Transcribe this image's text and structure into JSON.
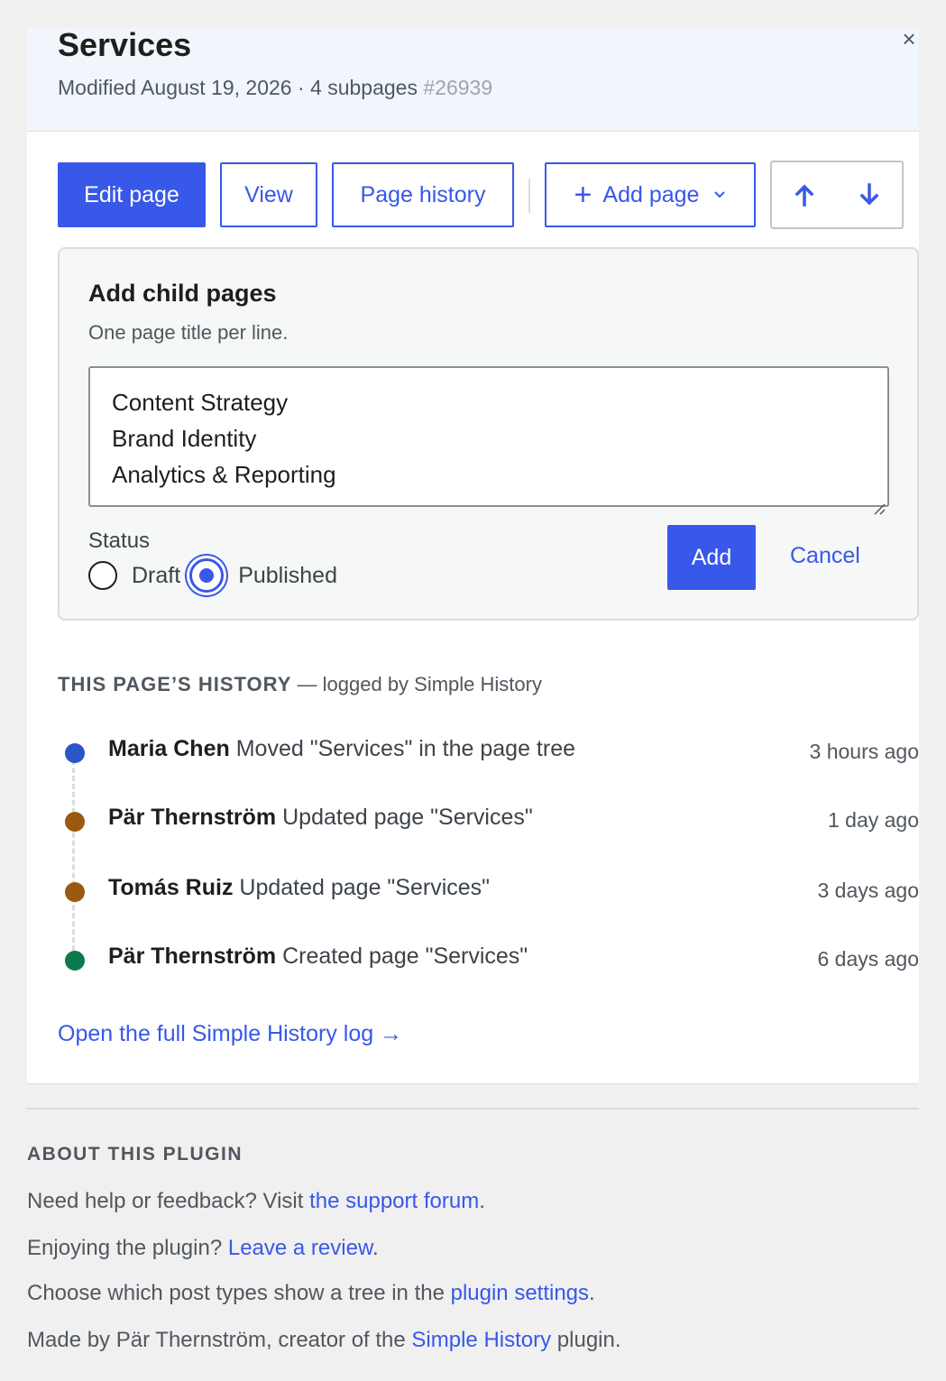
{
  "header": {
    "title": "Services",
    "modified": "Modified August 19, 2026",
    "separator": "·",
    "subpages": "4 subpages",
    "page_id": "#26939",
    "close_glyph": "×"
  },
  "toolbar": {
    "edit_label": "Edit page",
    "view_label": "View",
    "history_label": "Page history",
    "add_plus": "+",
    "add_label": "Add page",
    "add_caret": "⌄"
  },
  "add_child": {
    "title": "Add child pages",
    "hint": "One page title per line.",
    "lines": [
      "Content Strategy",
      "Brand Identity",
      "Analytics & Reporting"
    ],
    "status_label": "Status",
    "status_options": [
      "Draft",
      "Published"
    ],
    "selected_status": "Published",
    "add_label": "Add",
    "cancel_label": "Cancel"
  },
  "history": {
    "heading_caps": "THIS PAGE’S HISTORY",
    "heading_sub": " — logged by Simple History",
    "events": [
      {
        "user": "Maria Chen",
        "action": "Moved \"Services\" in the page tree",
        "time": "3 hours ago",
        "color": "#2c55c7"
      },
      {
        "user": "Pär Thernström",
        "action": "Updated page \"Services\"",
        "time": "1 day ago",
        "color": "#9a5a10"
      },
      {
        "user": "Tomás Ruiz",
        "action": "Updated page \"Services\"",
        "time": "3 days ago",
        "color": "#9a5a10"
      },
      {
        "user": "Pär Thernström",
        "action": "Created page \"Services\"",
        "time": "6 days ago",
        "color": "#0b7a4e"
      }
    ],
    "full_log_label": "Open the full Simple History log →"
  },
  "about": {
    "heading": "ABOUT THIS PLUGIN",
    "line1_pre": "Need help or feedback? Visit ",
    "line1_link": "the support forum",
    "line1_post": ".",
    "line2_pre": "Enjoying the plugin? ",
    "line2_link": "Leave a review",
    "line2_post": ".",
    "line3_pre": "Choose which post types show a tree in the ",
    "line3_link": "plugin settings",
    "line3_post": ".",
    "line4_pre": "Made by Pär Thernström, creator of the ",
    "line4_link": "Simple History",
    "line4_post": " plugin."
  },
  "colors": {
    "accent": "#3858e9",
    "panel_header_bg": "#f0f6fc",
    "page_bg": "#f0f0f1"
  }
}
